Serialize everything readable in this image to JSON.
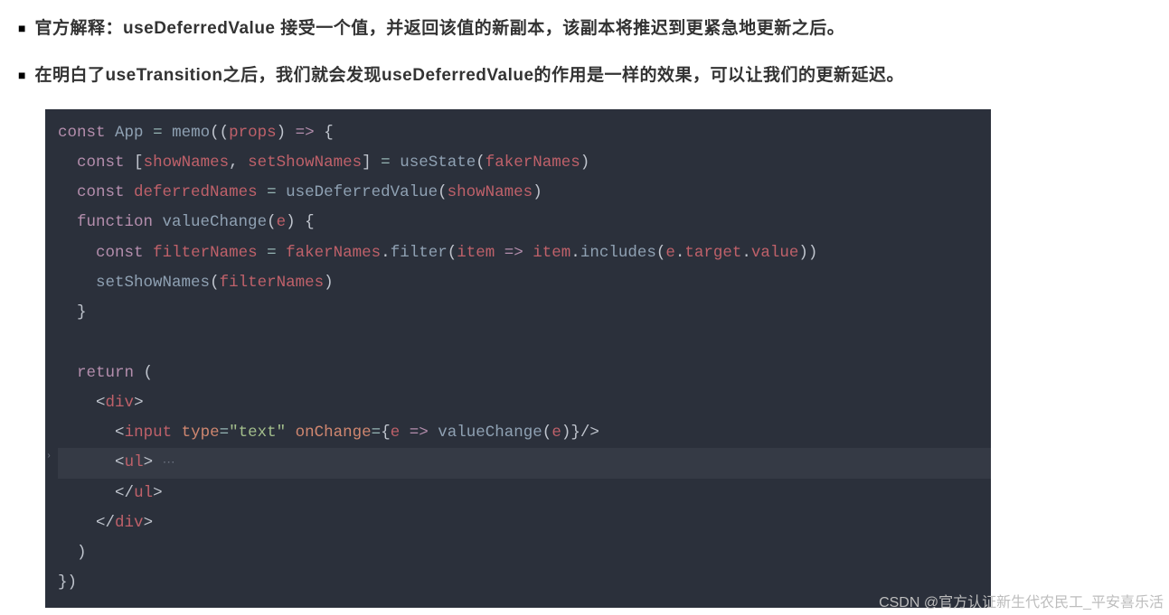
{
  "bullets": [
    "官方解释：useDeferredValue 接受一个值，并返回该值的新副本，该副本将推迟到更紧急地更新之后。",
    "在明白了useTransition之后，我们就会发现useDeferredValue的作用是一样的效果，可以让我们的更新延迟。"
  ],
  "code": {
    "tokens": {
      "const": "const",
      "function": "function",
      "return": "return",
      "App": "App",
      "memo": "memo",
      "props": "props",
      "showNames": "showNames",
      "setShowNames": "setShowNames",
      "useState": "useState",
      "fakerNames": "fakerNames",
      "deferredNames": "deferredNames",
      "useDeferredValue": "useDeferredValue",
      "valueChange": "valueChange",
      "e": "e",
      "filterNames": "filterNames",
      "filter": "filter",
      "item": "item",
      "includes": "includes",
      "target": "target",
      "value": "value",
      "div": "div",
      "input": "input",
      "type": "type",
      "text_str": "\"text\"",
      "onChange": "onChange",
      "ul": "ul"
    }
  },
  "watermark": "CSDN @官方认证新生代农民工_平安喜乐活"
}
